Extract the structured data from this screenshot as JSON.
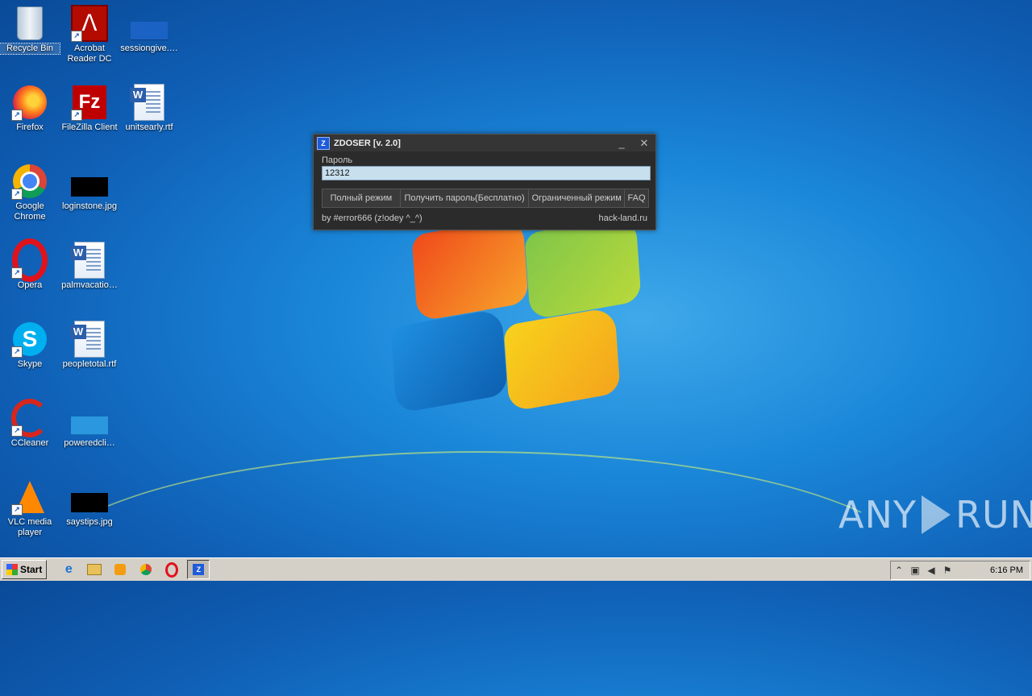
{
  "desktop": {
    "icons": [
      {
        "label": "Recycle Bin",
        "icon": "recycle-bin-icon"
      },
      {
        "label": "Acrobat Reader DC",
        "icon": "acrobat-icon"
      },
      {
        "label": "sessiongive.…",
        "icon": "image-file-icon"
      },
      {
        "label": "Firefox",
        "icon": "firefox-icon"
      },
      {
        "label": "FileZilla Client",
        "icon": "filezilla-icon"
      },
      {
        "label": "unitsearly.rtf",
        "icon": "word-doc-icon"
      },
      {
        "label": "Google Chrome",
        "icon": "chrome-icon"
      },
      {
        "label": "loginstone.jpg",
        "icon": "image-file-icon"
      },
      {
        "label": "Opera",
        "icon": "opera-icon"
      },
      {
        "label": "palmvacatio…",
        "icon": "word-doc-icon"
      },
      {
        "label": "Skype",
        "icon": "skype-icon"
      },
      {
        "label": "peopletotal.rtf",
        "icon": "word-doc-icon"
      },
      {
        "label": "CCleaner",
        "icon": "ccleaner-icon"
      },
      {
        "label": "poweredcli…",
        "icon": "image-file-icon"
      },
      {
        "label": "VLC media player",
        "icon": "vlc-icon"
      },
      {
        "label": "saystips.jpg",
        "icon": "image-file-icon"
      }
    ]
  },
  "dialog": {
    "title": "ZDOSER [v. 2.0]",
    "minimize_glyph": "_",
    "close_glyph": "✕",
    "password_label": "Пароль",
    "password_value": "12312",
    "buttons": {
      "full_mode": "Полный режим",
      "get_password": "Получить пароль(Бесплатно)",
      "limited_mode": "Ограниченный режим",
      "faq": "FAQ"
    },
    "footer_author": "by #error666 (z!odey ^_^)",
    "footer_site": "hack-land.ru"
  },
  "watermark": {
    "left": "ANY",
    "right": "RUN"
  },
  "taskbar": {
    "start_label": "Start",
    "clock": "6:16 PM",
    "pinned": [
      "internet-explorer-icon",
      "file-explorer-icon",
      "media-player-icon",
      "chrome-icon",
      "opera-icon",
      "zdoser-icon"
    ]
  },
  "colors": {
    "dialog_bg": "#2b2b2b",
    "input_bg": "#c8dfee",
    "taskbar_bg": "#d4d0c8"
  }
}
